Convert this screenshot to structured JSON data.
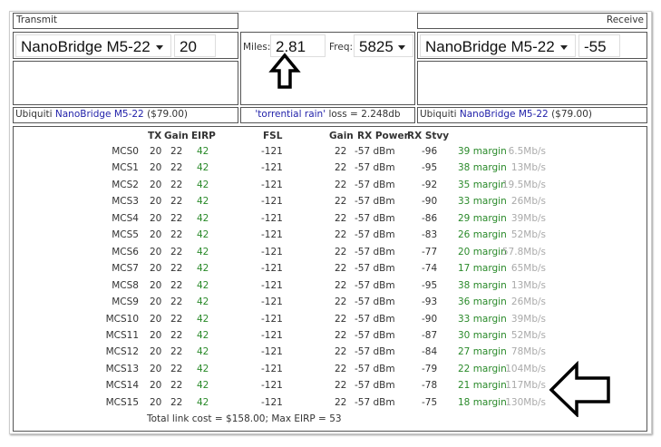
{
  "transmit": {
    "label": "Transmit",
    "device": "NanoBridge M5-22",
    "power": "20",
    "vendor": "Ubiquiti",
    "device_link": "NanoBridge M5-22",
    "price": "($79.00)"
  },
  "center": {
    "miles_label": "Miles:",
    "miles": "2.81",
    "freq_label": "Freq:",
    "freq": "5825",
    "rain_link": "'torrential rain'",
    "loss": "loss = 2.248db"
  },
  "receive": {
    "label": "Receive",
    "device": "NanoBridge M5-22",
    "sensitivity": "-55",
    "vendor": "Ubiquiti",
    "device_link": "NanoBridge M5-22",
    "price": "($79.00)"
  },
  "table": {
    "headers": [
      "TX",
      "Gain",
      "EIRP",
      "FSL",
      "Gain",
      "RX Power",
      "RX Stvy"
    ],
    "rows": [
      [
        "MCS0",
        "20",
        "22",
        "42",
        "-121",
        "22",
        "-57 dBm",
        "-96",
        "39 margin",
        "6.5Mb/s"
      ],
      [
        "MCS1",
        "20",
        "22",
        "42",
        "-121",
        "22",
        "-57 dBm",
        "-95",
        "38 margin",
        "13Mb/s"
      ],
      [
        "MCS2",
        "20",
        "22",
        "42",
        "-121",
        "22",
        "-57 dBm",
        "-92",
        "35 margin",
        "19.5Mb/s"
      ],
      [
        "MCS3",
        "20",
        "22",
        "42",
        "-121",
        "22",
        "-57 dBm",
        "-90",
        "33 margin",
        "26Mb/s"
      ],
      [
        "MCS4",
        "20",
        "22",
        "42",
        "-121",
        "22",
        "-57 dBm",
        "-86",
        "29 margin",
        "39Mb/s"
      ],
      [
        "MCS5",
        "20",
        "22",
        "42",
        "-121",
        "22",
        "-57 dBm",
        "-83",
        "26 margin",
        "52Mb/s"
      ],
      [
        "MCS6",
        "20",
        "22",
        "42",
        "-121",
        "22",
        "-57 dBm",
        "-77",
        "20 margin",
        "57.8Mb/s"
      ],
      [
        "MCS7",
        "20",
        "22",
        "42",
        "-121",
        "22",
        "-57 dBm",
        "-74",
        "17 margin",
        "65Mb/s"
      ],
      [
        "MCS8",
        "20",
        "22",
        "42",
        "-121",
        "22",
        "-57 dBm",
        "-95",
        "38 margin",
        "13Mb/s"
      ],
      [
        "MCS9",
        "20",
        "22",
        "42",
        "-121",
        "22",
        "-57 dBm",
        "-93",
        "36 margin",
        "26Mb/s"
      ],
      [
        "MCS10",
        "20",
        "22",
        "42",
        "-121",
        "22",
        "-57 dBm",
        "-90",
        "33 margin",
        "39Mb/s"
      ],
      [
        "MCS11",
        "20",
        "22",
        "42",
        "-121",
        "22",
        "-57 dBm",
        "-87",
        "30 margin",
        "52Mb/s"
      ],
      [
        "MCS12",
        "20",
        "22",
        "42",
        "-121",
        "22",
        "-57 dBm",
        "-84",
        "27 margin",
        "78Mb/s"
      ],
      [
        "MCS13",
        "20",
        "22",
        "42",
        "-121",
        "22",
        "-57 dBm",
        "-79",
        "22 margin",
        "104Mb/s"
      ],
      [
        "MCS14",
        "20",
        "22",
        "42",
        "-121",
        "22",
        "-57 dBm",
        "-78",
        "21 margin",
        "117Mb/s"
      ],
      [
        "MCS15",
        "20",
        "22",
        "42",
        "-121",
        "22",
        "-57 dBm",
        "-75",
        "18 margin",
        "130Mb/s"
      ]
    ],
    "total": "Total link cost = $158.00; Max EIRP = 53"
  },
  "colors": {
    "margin": "#2a8a2a",
    "speed": "#aaaaaa",
    "link": "#2222aa"
  }
}
